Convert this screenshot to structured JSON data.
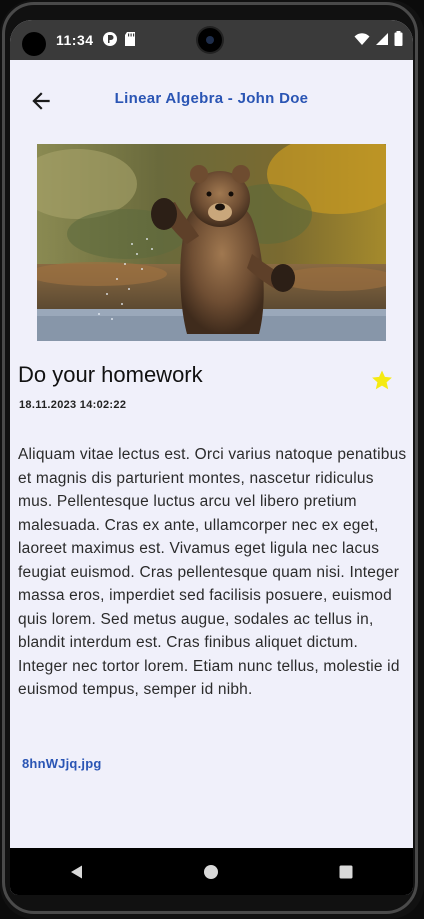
{
  "status_bar": {
    "time": "11:34"
  },
  "app_bar": {
    "title": "Linear Algebra - John Doe"
  },
  "note": {
    "title": "Do your homework",
    "date": "18.11.2023 14:02:22",
    "starred": true,
    "body": "Aliquam vitae lectus est. Orci varius natoque penatibus et magnis dis parturient montes, nascetur ridiculus mus. Pellentesque luctus arcu vel libero pretium malesuada. Cras ex ante, ullamcorper nec ex eget, laoreet maximus est. Vivamus eget ligula nec lacus feugiat euismod. Cras pellentesque quam nisi. Integer massa eros, imperdiet sed facilisis posuere, euismod quis lorem. Sed metus augue, sodales ac tellus in, blandit interdum est. Cras finibus aliquet dictum. Integer nec tortor lorem. Etiam nunc tellus, molestie id euismod tempus, semper id nibh.",
    "attachment": "8hnWJjq.jpg"
  },
  "icons": {
    "back": "arrow-back-icon",
    "star": "star-icon",
    "nav_back": "triangle-back-icon",
    "nav_home": "circle-home-icon",
    "nav_recents": "square-recents-icon"
  },
  "colors": {
    "accent": "#2a55b4",
    "star": "#f5ea12",
    "background": "#f0f0fa"
  }
}
